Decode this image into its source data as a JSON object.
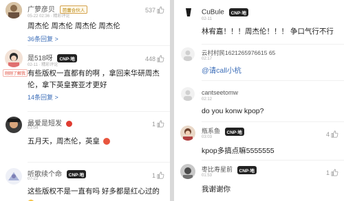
{
  "left": {
    "c1": {
      "user": "广萝彦贝",
      "badge": "芭蕾合伙人",
      "meta": "05-22 02:36 · 精彩评论",
      "text": "周杰伦 周杰伦 周杰伦 周杰伦",
      "replies": "36条回复 >",
      "likes": "537"
    },
    "c2": {
      "user": "是518呀",
      "badge": "CNP·地",
      "meta": "02-11 · 精彩评论",
      "tag": "刚刚了解我",
      "text": "有些版权一直都有的啊 ，拿回来华研周杰伦，拿下英皇赛亚才更好",
      "replies": "14条回复 >",
      "likes": "448"
    },
    "c3": {
      "user": "最爱是短发",
      "meta": "03-04",
      "text": "五月天，周杰伦，英皇",
      "likes": "1"
    },
    "c4": {
      "user": "听歌续个命",
      "badge": "CNP·地",
      "meta": "07-22",
      "text": "这些版权不是一直有吗 好多都是红心过的",
      "likes": "1"
    }
  },
  "right": {
    "c1": {
      "user": "CuBule",
      "badge": "CNP·地",
      "meta": "02-11",
      "text": "林宥嘉！！！周杰伦！！！ 争口气行不行"
    },
    "c2": {
      "user": "云村村民1621265976615 65",
      "meta": "02:17",
      "text": "@请call小杭"
    },
    "c3": {
      "user": "cantseetomw",
      "meta": "02:12",
      "text": "do you konw kpop?"
    },
    "c4": {
      "user": "瓶系鱼",
      "badge": "CNP·地",
      "meta": "03:03",
      "text": "kpop多搞点嘛5555555",
      "likes": "4"
    },
    "c5": {
      "user": "枣比寿星前",
      "badge": "CNP·地",
      "meta": "01:53",
      "text": "我谢谢你",
      "likes": "1"
    }
  }
}
